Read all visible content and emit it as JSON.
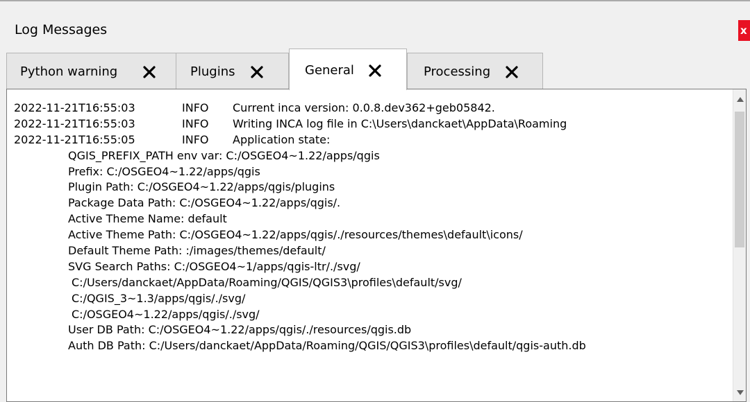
{
  "window": {
    "title": "Log Messages",
    "close_label": "x"
  },
  "tabs": [
    {
      "label": "Python warning",
      "active": false
    },
    {
      "label": "Plugins",
      "active": false
    },
    {
      "label": "General",
      "active": true
    },
    {
      "label": "Processing",
      "active": false
    }
  ],
  "log": {
    "entries": [
      {
        "timestamp": "2022-11-21T16:55:03",
        "level": "INFO",
        "message": "Current inca version: 0.0.8.dev362+geb05842."
      },
      {
        "timestamp": "2022-11-21T16:55:03",
        "level": "INFO",
        "message": "Writing INCA log file in C:\\Users\\danckaet\\AppData\\Roaming"
      },
      {
        "timestamp": "2022-11-21T16:55:05",
        "level": "INFO",
        "message": "Application state:"
      }
    ],
    "details": [
      "QGIS_PREFIX_PATH env var: C:/OSGEO4~1.22/apps/qgis",
      "Prefix: C:/OSGEO4~1.22/apps/qgis",
      "Plugin Path: C:/OSGEO4~1.22/apps/qgis/plugins",
      "Package Data Path: C:/OSGEO4~1.22/apps/qgis/.",
      "Active Theme Name: default",
      "Active Theme Path: C:/OSGEO4~1.22/apps/qgis/./resources/themes\\default\\icons/",
      "Default Theme Path: :/images/themes/default/",
      "SVG Search Paths: C:/OSGEO4~1/apps/qgis-ltr/./svg/"
    ],
    "svg_paths": [
      "C:/Users/danckaet/AppData/Roaming/QGIS/QGIS3\\profiles\\default/svg/",
      "C:/QGIS_3~1.3/apps/qgis/./svg/",
      "C:/OSGEO4~1.22/apps/qgis/./svg/"
    ],
    "db_paths": [
      "User DB Path: C:/OSGEO4~1.22/apps/qgis/./resources/qgis.db",
      "Auth DB Path: C:/Users/danckaet/AppData/Roaming/QGIS/QGIS3\\profiles\\default/qgis-auth.db"
    ]
  },
  "icons": {
    "tab_close": "close-x-icon",
    "scroll_up": "triangle-up-icon",
    "scroll_down": "triangle-down-icon"
  },
  "colors": {
    "close_button": "#e81123",
    "active_tab": "#ffffff",
    "inactive_tab": "#e6e6e6",
    "panel_bg": "#f0f0f0"
  }
}
